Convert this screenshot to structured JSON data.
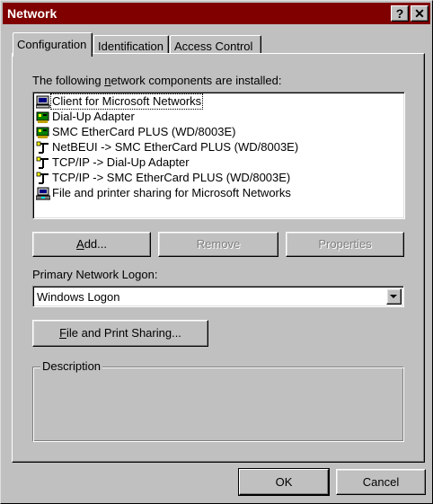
{
  "window": {
    "title": "Network",
    "help_label": "?",
    "close_label": "✕"
  },
  "tabs": [
    {
      "label": "Configuration",
      "active": true
    },
    {
      "label": "Identification",
      "active": false
    },
    {
      "label": "Access Control",
      "active": false
    }
  ],
  "components": {
    "label_pre": "The following ",
    "label_accel": "n",
    "label_post": "etwork components are installed:",
    "items": [
      {
        "label": "Client for Microsoft Networks",
        "icon": "client-icon",
        "selected": true
      },
      {
        "label": "Dial-Up Adapter",
        "icon": "adapter-icon",
        "selected": false
      },
      {
        "label": "SMC EtherCard PLUS (WD/8003E)",
        "icon": "adapter-icon",
        "selected": false
      },
      {
        "label": "NetBEUI -> SMC EtherCard PLUS (WD/8003E)",
        "icon": "protocol-icon",
        "selected": false
      },
      {
        "label": "TCP/IP -> Dial-Up Adapter",
        "icon": "protocol-icon",
        "selected": false
      },
      {
        "label": "TCP/IP -> SMC EtherCard PLUS (WD/8003E)",
        "icon": "protocol-icon",
        "selected": false
      },
      {
        "label": "File and printer sharing for Microsoft Networks",
        "icon": "service-icon",
        "selected": false
      }
    ]
  },
  "buttons": {
    "add_accel": "A",
    "add_rest": "dd...",
    "remove": "Remove",
    "properties": "Properties",
    "file_sharing_accel": "F",
    "file_sharing_rest": "ile and Print Sharing...",
    "ok": "OK",
    "cancel": "Cancel"
  },
  "logon": {
    "label": "Primary Network Logon:",
    "value": "Windows Logon"
  },
  "description": {
    "legend": "Description"
  },
  "colors": {
    "titlebar": "#800000",
    "face": "#c0c0c0"
  }
}
